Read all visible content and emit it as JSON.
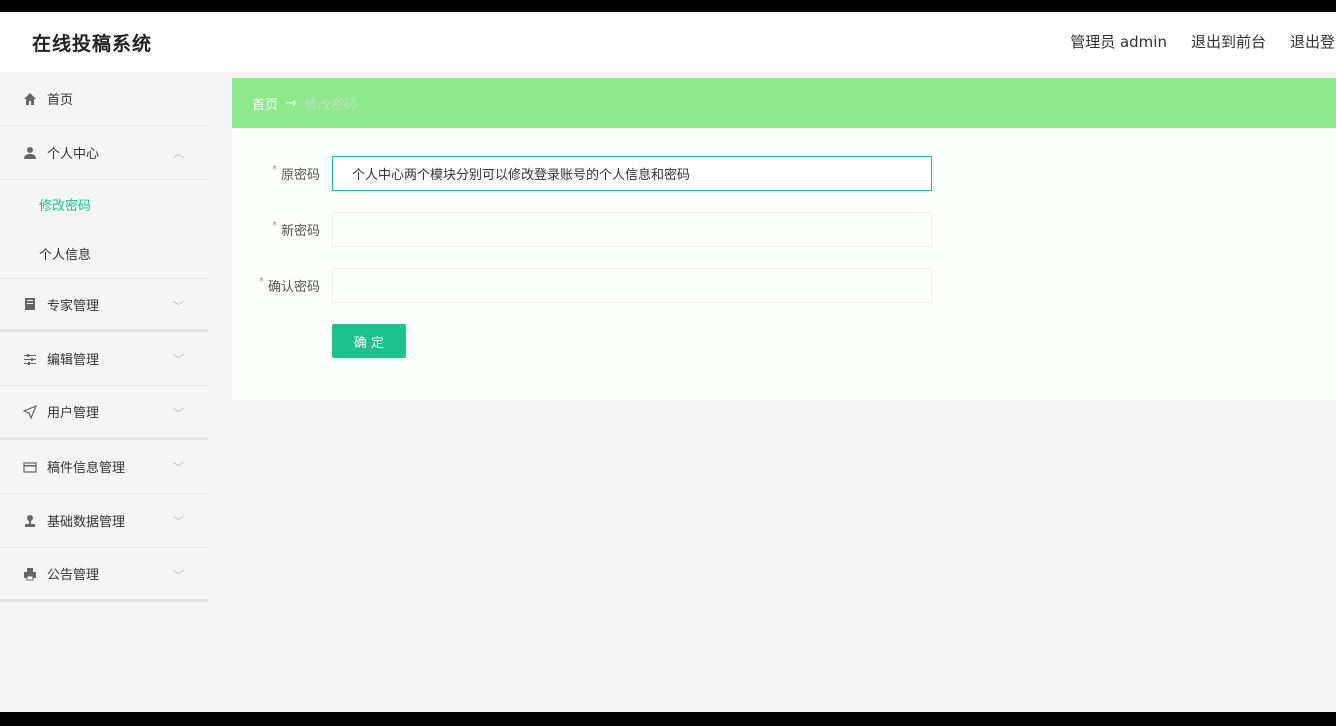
{
  "app": {
    "title": "在线投稿系统"
  },
  "header": {
    "admin_label": "管理员 admin",
    "front_link": "退出到前台",
    "logout_link": "退出登录"
  },
  "sidebar": {
    "items": [
      {
        "label": "首页",
        "icon": "home-icon"
      },
      {
        "label": "个人中心",
        "icon": "user-icon"
      },
      {
        "label": "专家管理",
        "icon": "book-icon"
      },
      {
        "label": "编辑管理",
        "icon": "sliders-icon"
      },
      {
        "label": "用户管理",
        "icon": "send-icon"
      },
      {
        "label": "稿件信息管理",
        "icon": "card-icon"
      },
      {
        "label": "基础数据管理",
        "icon": "stamp-icon"
      },
      {
        "label": "公告管理",
        "icon": "printer-icon"
      }
    ],
    "sub_items": [
      {
        "label": "修改密码",
        "active": true
      },
      {
        "label": "个人信息",
        "active": false
      }
    ]
  },
  "breadcrumb": {
    "home": "首页",
    "arrow": "→",
    "current": "修改密码"
  },
  "form": {
    "old_password_label": "原密码",
    "old_password_value": "个人中心两个模块分别可以修改登录账号的个人信息和密码",
    "new_password_label": "新密码",
    "new_password_value": "",
    "confirm_password_label": "确认密码",
    "confirm_password_value": "",
    "required_mark": "*",
    "submit_label": "确 定"
  },
  "colors": {
    "accent": "#1fc28f",
    "breadcrumb_bg": "#8ee98a"
  }
}
